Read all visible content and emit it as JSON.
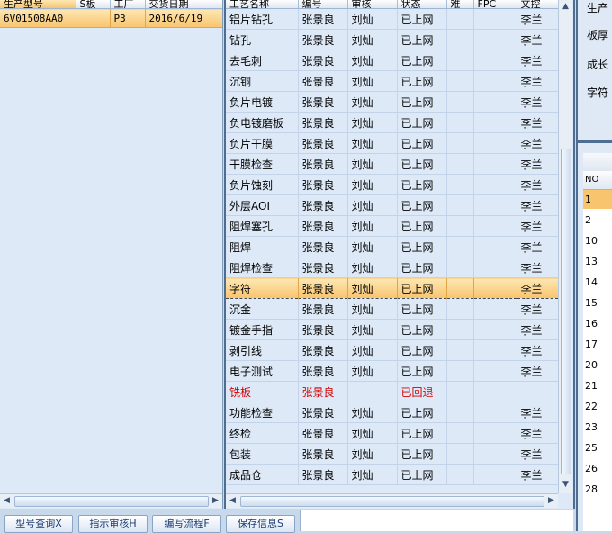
{
  "left_grid": {
    "columns": [
      "生产型号",
      "S板",
      "工厂",
      "交货日期"
    ],
    "rows": [
      {
        "model": "6V01508AA0",
        "s": "",
        "factory": "P3",
        "date": "2016/6/19"
      }
    ]
  },
  "mid_grid": {
    "columns": [
      "工艺名称",
      "编号",
      "审核",
      "状态",
      "难",
      "FPC",
      "文控"
    ],
    "rows": [
      {
        "name": "铝片钻孔",
        "code": "张景良",
        "review": "刘灿",
        "status": "已上网",
        "nan": "",
        "fpc": "",
        "ctrl": "李兰"
      },
      {
        "name": "钻孔",
        "code": "张景良",
        "review": "刘灿",
        "status": "已上网",
        "nan": "",
        "fpc": "",
        "ctrl": "李兰"
      },
      {
        "name": "去毛刺",
        "code": "张景良",
        "review": "刘灿",
        "status": "已上网",
        "nan": "",
        "fpc": "",
        "ctrl": "李兰"
      },
      {
        "name": "沉铜",
        "code": "张景良",
        "review": "刘灿",
        "status": "已上网",
        "nan": "",
        "fpc": "",
        "ctrl": "李兰"
      },
      {
        "name": "负片电镀",
        "code": "张景良",
        "review": "刘灿",
        "status": "已上网",
        "nan": "",
        "fpc": "",
        "ctrl": "李兰"
      },
      {
        "name": "负电镀磨板",
        "code": "张景良",
        "review": "刘灿",
        "status": "已上网",
        "nan": "",
        "fpc": "",
        "ctrl": "李兰"
      },
      {
        "name": "负片干膜",
        "code": "张景良",
        "review": "刘灿",
        "status": "已上网",
        "nan": "",
        "fpc": "",
        "ctrl": "李兰"
      },
      {
        "name": "干膜检查",
        "code": "张景良",
        "review": "刘灿",
        "status": "已上网",
        "nan": "",
        "fpc": "",
        "ctrl": "李兰"
      },
      {
        "name": "负片蚀刻",
        "code": "张景良",
        "review": "刘灿",
        "status": "已上网",
        "nan": "",
        "fpc": "",
        "ctrl": "李兰"
      },
      {
        "name": "外层AOI",
        "code": "张景良",
        "review": "刘灿",
        "status": "已上网",
        "nan": "",
        "fpc": "",
        "ctrl": "李兰"
      },
      {
        "name": "阻焊塞孔",
        "code": "张景良",
        "review": "刘灿",
        "status": "已上网",
        "nan": "",
        "fpc": "",
        "ctrl": "李兰"
      },
      {
        "name": "阻焊",
        "code": "张景良",
        "review": "刘灿",
        "status": "已上网",
        "nan": "",
        "fpc": "",
        "ctrl": "李兰"
      },
      {
        "name": "阻焊检查",
        "code": "张景良",
        "review": "刘灿",
        "status": "已上网",
        "nan": "",
        "fpc": "",
        "ctrl": "李兰"
      },
      {
        "name": "字符",
        "code": "张景良",
        "review": "刘灿",
        "status": "已上网",
        "nan": "",
        "fpc": "",
        "ctrl": "李兰"
      },
      {
        "name": "沉金",
        "code": "张景良",
        "review": "刘灿",
        "status": "已上网",
        "nan": "",
        "fpc": "",
        "ctrl": "李兰"
      },
      {
        "name": "镀金手指",
        "code": "张景良",
        "review": "刘灿",
        "status": "已上网",
        "nan": "",
        "fpc": "",
        "ctrl": "李兰"
      },
      {
        "name": "剥引线",
        "code": "张景良",
        "review": "刘灿",
        "status": "已上网",
        "nan": "",
        "fpc": "",
        "ctrl": "李兰"
      },
      {
        "name": "电子测试",
        "code": "张景良",
        "review": "刘灿",
        "status": "已上网",
        "nan": "",
        "fpc": "",
        "ctrl": "李兰"
      },
      {
        "name": "铣板",
        "code": "张景良",
        "review": "",
        "status": "已回退",
        "nan": "",
        "fpc": "",
        "ctrl": ""
      },
      {
        "name": "功能检查",
        "code": "张景良",
        "review": "刘灿",
        "status": "已上网",
        "nan": "",
        "fpc": "",
        "ctrl": "李兰"
      },
      {
        "name": "终检",
        "code": "张景良",
        "review": "刘灿",
        "status": "已上网",
        "nan": "",
        "fpc": "",
        "ctrl": "李兰"
      },
      {
        "name": "包装",
        "code": "张景良",
        "review": "刘灿",
        "status": "已上网",
        "nan": "",
        "fpc": "",
        "ctrl": "李兰"
      },
      {
        "name": "成品仓",
        "code": "张景良",
        "review": "刘灿",
        "status": "已上网",
        "nan": "",
        "fpc": "",
        "ctrl": "李兰"
      }
    ]
  },
  "right_panel": {
    "labels": [
      "生产",
      "板厚",
      "成长",
      "字符"
    ],
    "list_header": "NO",
    "list_numbers": [
      "1",
      "2",
      "10",
      "13",
      "14",
      "15",
      "16",
      "17",
      "20",
      "21",
      "22",
      "23",
      "25",
      "26",
      "28"
    ]
  },
  "toolbar": {
    "query": "型号查询X",
    "review": "指示审核H",
    "flow": "编写流程F",
    "save": "保存信息S"
  },
  "colors": {
    "selection": "#f8c46d",
    "rolled_back": "#d40000"
  }
}
